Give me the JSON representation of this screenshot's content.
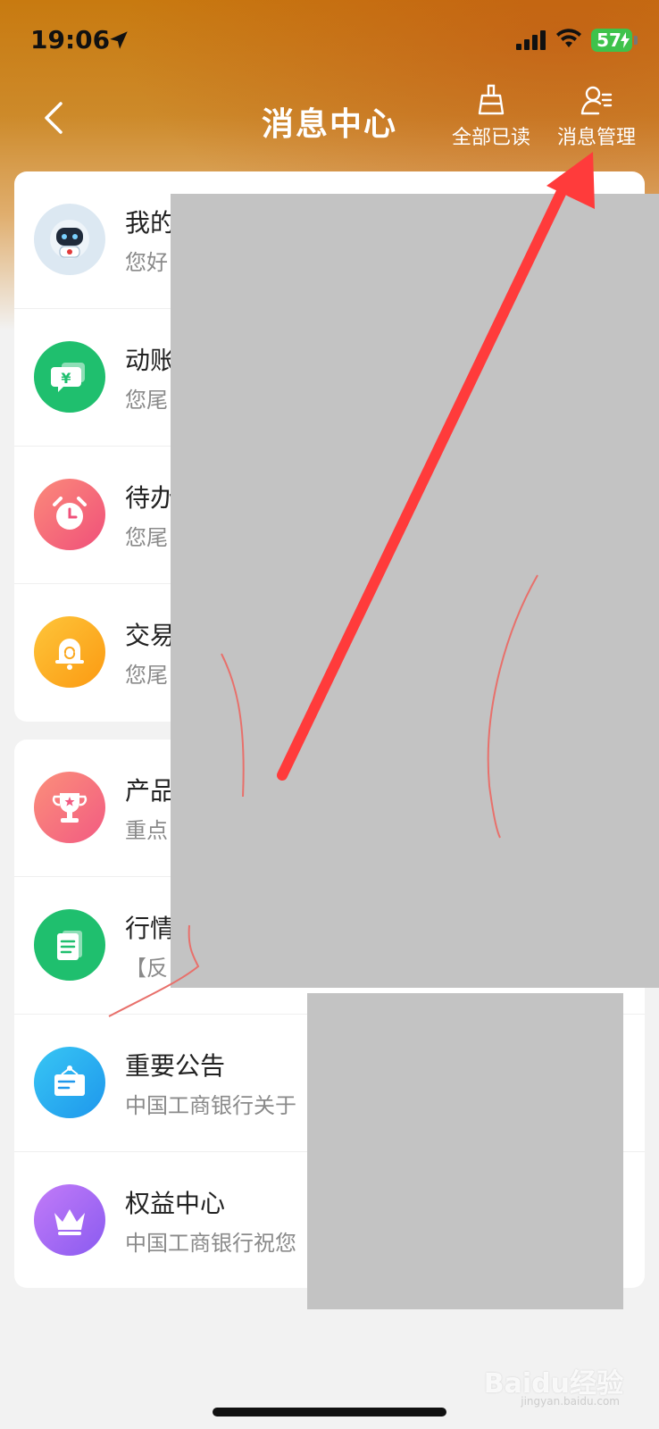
{
  "status_bar": {
    "time": "19:06",
    "battery": "57",
    "battery_color": "#3ec24b"
  },
  "nav": {
    "title": "消息中心",
    "mark_all_read": "全部已读",
    "message_settings": "消息管理",
    "back_icon": "chevron-left-icon",
    "mark_all_read_icon": "broom-icon",
    "message_settings_icon": "user-settings-icon"
  },
  "card_1": {
    "items": [
      {
        "title": "我的",
        "subtitle": "您好",
        "icon": "robot-assistant-icon",
        "color": "#7fb0d8"
      },
      {
        "title": "动账",
        "subtitle": "您尾",
        "icon": "yuan-chat-icon",
        "color": "#1fbf6e"
      },
      {
        "title": "待办",
        "subtitle": "您尾",
        "icon": "alarm-clock-icon",
        "color": "#f5607a"
      },
      {
        "title": "交易",
        "subtitle": "您尾",
        "icon": "bell-icon",
        "color": "#fbaa1e"
      }
    ]
  },
  "card_2": {
    "items": [
      {
        "title": "产品",
        "subtitle": "重点",
        "icon": "trophy-icon",
        "color": "#f46a7f"
      },
      {
        "title": "行情",
        "subtitle": "【反",
        "icon": "document-icon",
        "color": "#1fbf6e"
      },
      {
        "title": "重要公告",
        "subtitle": "中国工商银行关于",
        "icon": "notice-board-icon",
        "color": "#2aaef0"
      },
      {
        "title": "权益中心",
        "subtitle": "中国工商银行祝您",
        "icon": "crown-icon",
        "color": "#a468f3"
      }
    ]
  },
  "annotation": {
    "arrow_color": "#ff3b3b"
  },
  "watermark": {
    "text": "Baidu经验",
    "sub": "jingyan.baidu.com"
  }
}
